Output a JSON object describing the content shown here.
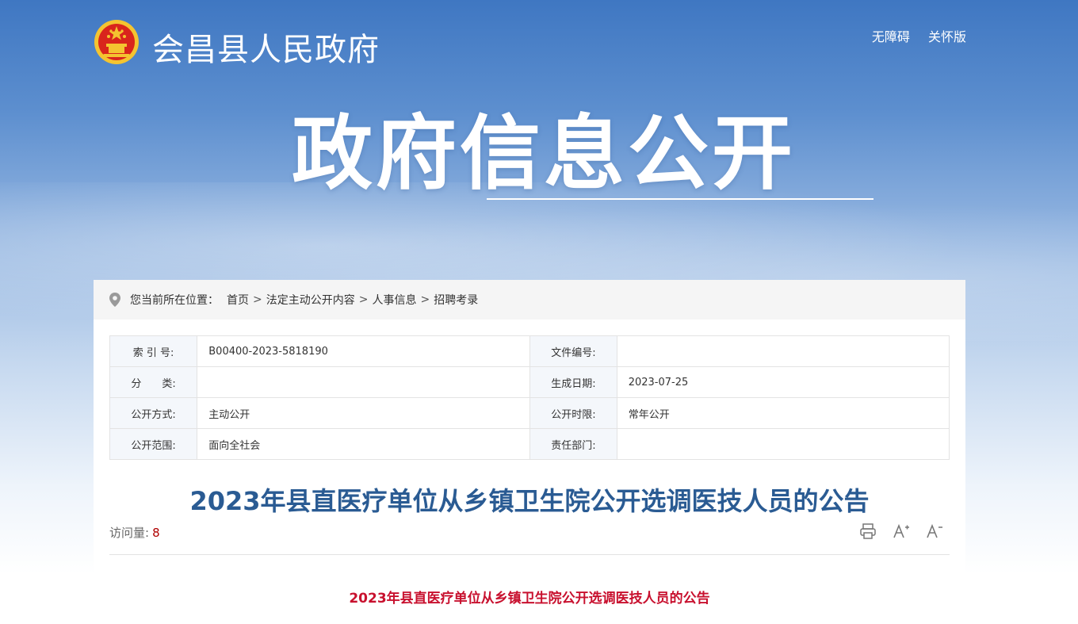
{
  "header": {
    "site_name": "会昌县人民政府",
    "links": [
      "无障碍",
      "关怀版"
    ]
  },
  "hero": {
    "title": "政府信息公开"
  },
  "breadcrumb": {
    "prefix": "您当前所在位置：",
    "items": [
      "首页",
      "法定主动公开内容",
      "人事信息",
      "招聘考录"
    ],
    "separator": ">"
  },
  "meta": {
    "rows": [
      {
        "k1": "索 引 号:",
        "v1": "B00400-2023-5818190",
        "k2": "文件编号:",
        "v2": ""
      },
      {
        "k1": "分　　类:",
        "v1": "",
        "k2": "生成日期:",
        "v2": "2023-07-25"
      },
      {
        "k1": "公开方式:",
        "v1": "主动公开",
        "k2": "公开时限:",
        "v2": "常年公开"
      },
      {
        "k1": "公开范围:",
        "v1": "面向全社会",
        "k2": "责任部门:",
        "v2": ""
      }
    ]
  },
  "article": {
    "title": "2023年县直医疗单位从乡镇卫生院公开选调医技人员的公告",
    "visits_label": "访问量:",
    "visits_count": "8",
    "body_title": "2023年县直医疗单位从乡镇卫生院公开选调医技人员的公告"
  },
  "colors": {
    "title_blue": "#2a5b93",
    "body_title_red": "#c8102e",
    "emblem_red": "#d9251c",
    "emblem_gold": "#f4c430"
  },
  "icons": [
    "national-emblem-icon",
    "location-pin-icon",
    "print-icon",
    "font-increase-icon",
    "font-decrease-icon"
  ]
}
